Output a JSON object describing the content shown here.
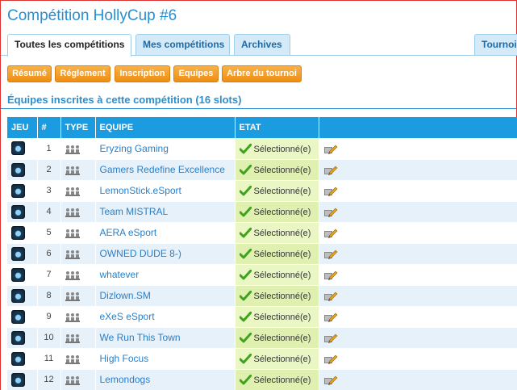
{
  "page": {
    "title": "Compétition HollyCup #6"
  },
  "tabs": [
    {
      "label": "Toutes les compétitions"
    },
    {
      "label": "Mes compétitions"
    },
    {
      "label": "Archives"
    },
    {
      "label": "Tournoi"
    }
  ],
  "actions": [
    {
      "label": "Résumé"
    },
    {
      "label": "Réglement"
    },
    {
      "label": "Inscription"
    },
    {
      "label": "Equipes"
    },
    {
      "label": "Arbre du tournoi"
    }
  ],
  "section": {
    "title": "Équipes inscrites à cette compétition (16 slots)"
  },
  "table": {
    "headers": [
      "JEU",
      "#",
      "TYPE",
      "EQUIPE",
      "ETAT",
      ""
    ],
    "rows": [
      {
        "num": "1",
        "team": "Eryzing Gaming",
        "status": "Sélectionné(e)"
      },
      {
        "num": "2",
        "team": "Gamers Redefine Excellence",
        "status": "Sélectionné(e)"
      },
      {
        "num": "3",
        "team": "LemonStick.eSport",
        "status": "Sélectionné(e)"
      },
      {
        "num": "4",
        "team": "Team MISTRAL",
        "status": "Sélectionné(e)"
      },
      {
        "num": "5",
        "team": "AERA eSport",
        "status": "Sélectionné(e)"
      },
      {
        "num": "6",
        "team": "OWNED DUDE 8-)",
        "status": "Sélectionné(e)"
      },
      {
        "num": "7",
        "team": "whatever",
        "status": "Sélectionné(e)"
      },
      {
        "num": "8",
        "team": "Dizlown.SM",
        "status": "Sélectionné(e)"
      },
      {
        "num": "9",
        "team": "eXeS eSport",
        "status": "Sélectionné(e)"
      },
      {
        "num": "10",
        "team": "We Run This Town",
        "status": "Sélectionné(e)"
      },
      {
        "num": "11",
        "team": "High Focus",
        "status": "Sélectionné(e)"
      },
      {
        "num": "12",
        "team": "Lemondogs",
        "status": "Sélectionné(e)"
      }
    ]
  },
  "colors": {
    "title": "#2a8fd0",
    "header_bg": "#1c9ce0",
    "button_orange": "#ef8d12",
    "status_bg": "#eaf6c4",
    "link": "#2a7fc7"
  },
  "icons": {
    "game": "game-logo-icon",
    "type": "team-type-icon",
    "status": "check-icon",
    "action": "edit-icon"
  }
}
